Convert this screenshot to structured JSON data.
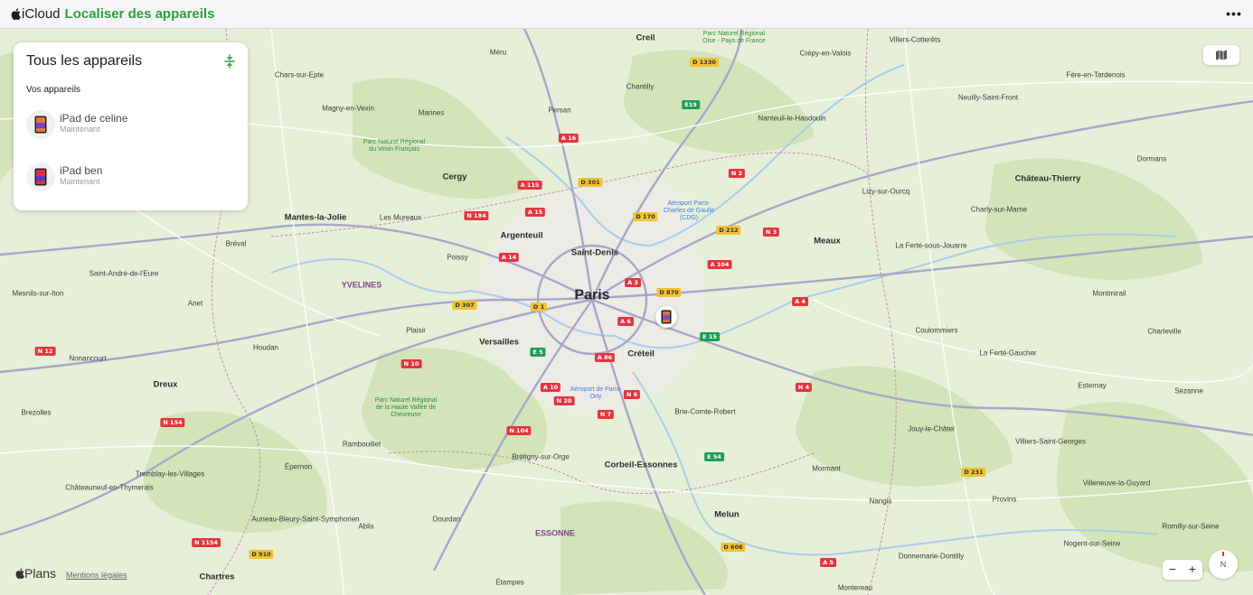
{
  "topbar": {
    "icloud_label": "iCloud",
    "app_title": "Localiser des appareils",
    "more_label": "•••"
  },
  "panel": {
    "title": "Tous les appareils",
    "section_title": "Vos appareils",
    "devices": [
      {
        "name": "iPad de celine",
        "status": "Maintenant"
      },
      {
        "name": "iPad ben",
        "status": "Maintenant"
      }
    ]
  },
  "map": {
    "attribution_logo": "Plans",
    "legal_link": "Mentions légales",
    "zoom_out": "−",
    "zoom_in": "+",
    "compass_label": "N",
    "places": [
      "Creil",
      "Méru",
      "Chantilly",
      "Persan",
      "Crépy-en-Valois",
      "Villers-Cotterêts",
      "Cergy",
      "Marines",
      "Magny-en-Vexin",
      "Mantes-la-Jolie",
      "Les Mureaux",
      "Argenteuil",
      "Saint-Denis",
      "Paris",
      "Poissy",
      "Versailles",
      "Plaisir",
      "Créteil",
      "Meaux",
      "Château-Thierry",
      "Dormans",
      "Fère-en-Tardenois",
      "Dreux",
      "Rambouillet",
      "Chartres",
      "Corbeil-Essonnes",
      "Melun",
      "Brie-Comte-Robert",
      "Brétigny-sur-Orge",
      "Étampes",
      "Dourdan",
      "Provins",
      "Coulommiers",
      "Nangis",
      "Houdan",
      "Épernon",
      "Sézanne",
      "Esternay",
      "Montmirail",
      "Charleville",
      "La Ferté-Gaucher",
      "Mormant",
      "Villeneuve-la-Guyard",
      "Romilly-sur-Seine",
      "Nogent-sur-Seine",
      "Nanteuil-le-Haudouin",
      "Lizy-sur-Ourcq",
      "Charly-sur-Marne",
      "La Ferté-sous-Jouarre",
      "Anet",
      "Brezolles",
      "Nonancourt",
      "Mesnils-sur-Iton",
      "Saint-André-de-l'Eure",
      "Bréval",
      "Ablis",
      "Auneau-Bleury-Saint-Symphorien",
      "Tremblay-les-Villages",
      "Châteauneuf-en-Thymerais",
      "Neuilly-Saint-Front",
      "Donnemarie-Dontilly",
      "Villiers-Saint-Georges",
      "Jouy-le-Châtel",
      "Chars-sur-Epte",
      "Montereau"
    ],
    "regions": [
      "YVELINES",
      "ESSONNE"
    ],
    "parks": [
      "Parc Naturel Régional du Vexin Français",
      "Parc Naturel Régional de la Haute Vallée de Chevreuse",
      "Parc Naturel Régional Oise - Pays de France"
    ],
    "airports": [
      "Aéroport Paris-Charles de Gaulle (CDG)",
      "Aéroport de Paris-Orly"
    ],
    "roads": [
      "D 1330",
      "E19",
      "A 16",
      "N 2",
      "D 301",
      "A 115",
      "A 15",
      "D 170",
      "N 184",
      "D 212",
      "N 3",
      "A 14",
      "A 104",
      "A 3",
      "D 307",
      "D 1",
      "D 870",
      "A 4",
      "A 6",
      "E 15",
      "E 5",
      "N 10",
      "A 86",
      "N 6",
      "A 10",
      "N 20",
      "N 7",
      "N 104",
      "E 54",
      "D 231",
      "D 606",
      "N 12",
      "N 154",
      "N 1154",
      "D 910",
      "A 5",
      "N 4"
    ]
  }
}
